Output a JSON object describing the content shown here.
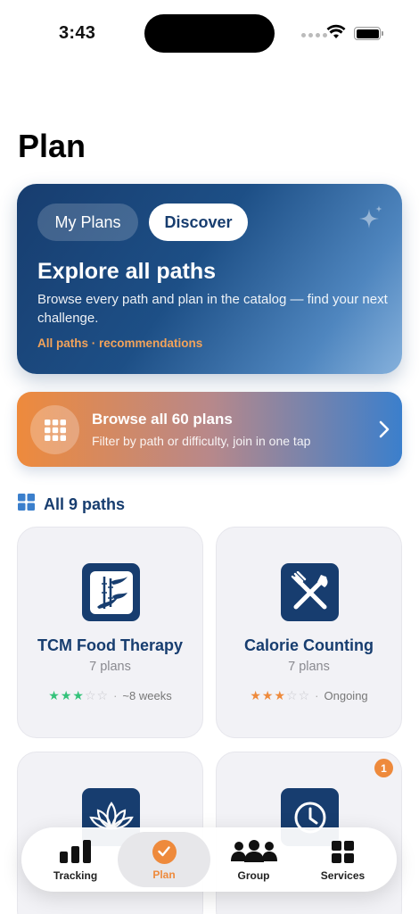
{
  "status_bar": {
    "time": "3:43"
  },
  "page": {
    "title": "Plan"
  },
  "hero": {
    "segments": {
      "my_plans": "My Plans",
      "discover": "Discover"
    },
    "title": "Explore all paths",
    "description": "Browse every path and plan in the catalog — find your next challenge.",
    "link": "All paths · recommendations"
  },
  "browse": {
    "title": "Browse all 60 plans",
    "subtitle": "Filter by path or difficulty, join in one tap"
  },
  "paths_section": {
    "title": "All 9 paths"
  },
  "paths": [
    {
      "title": "TCM Food Therapy",
      "count": "7 plans",
      "rating": 3,
      "max_rating": 5,
      "duration": "~8 weeks",
      "star_color": "#34c27a",
      "icon": "bamboo-icon"
    },
    {
      "title": "Calorie Counting",
      "count": "7 plans",
      "rating": 3,
      "max_rating": 5,
      "duration": "Ongoing",
      "star_color": "#ee8a3c",
      "icon": "fork-knife-icon"
    },
    {
      "icon": "lotus-icon"
    },
    {
      "icon": "clock-icon",
      "badge": "1"
    }
  ],
  "tabbar": {
    "tracking": "Tracking",
    "plan": "Plan",
    "group": "Group",
    "services": "Services"
  },
  "colors": {
    "navy": "#173d6f",
    "accent_orange": "#ee8a3c",
    "accent_green": "#34c27a"
  }
}
